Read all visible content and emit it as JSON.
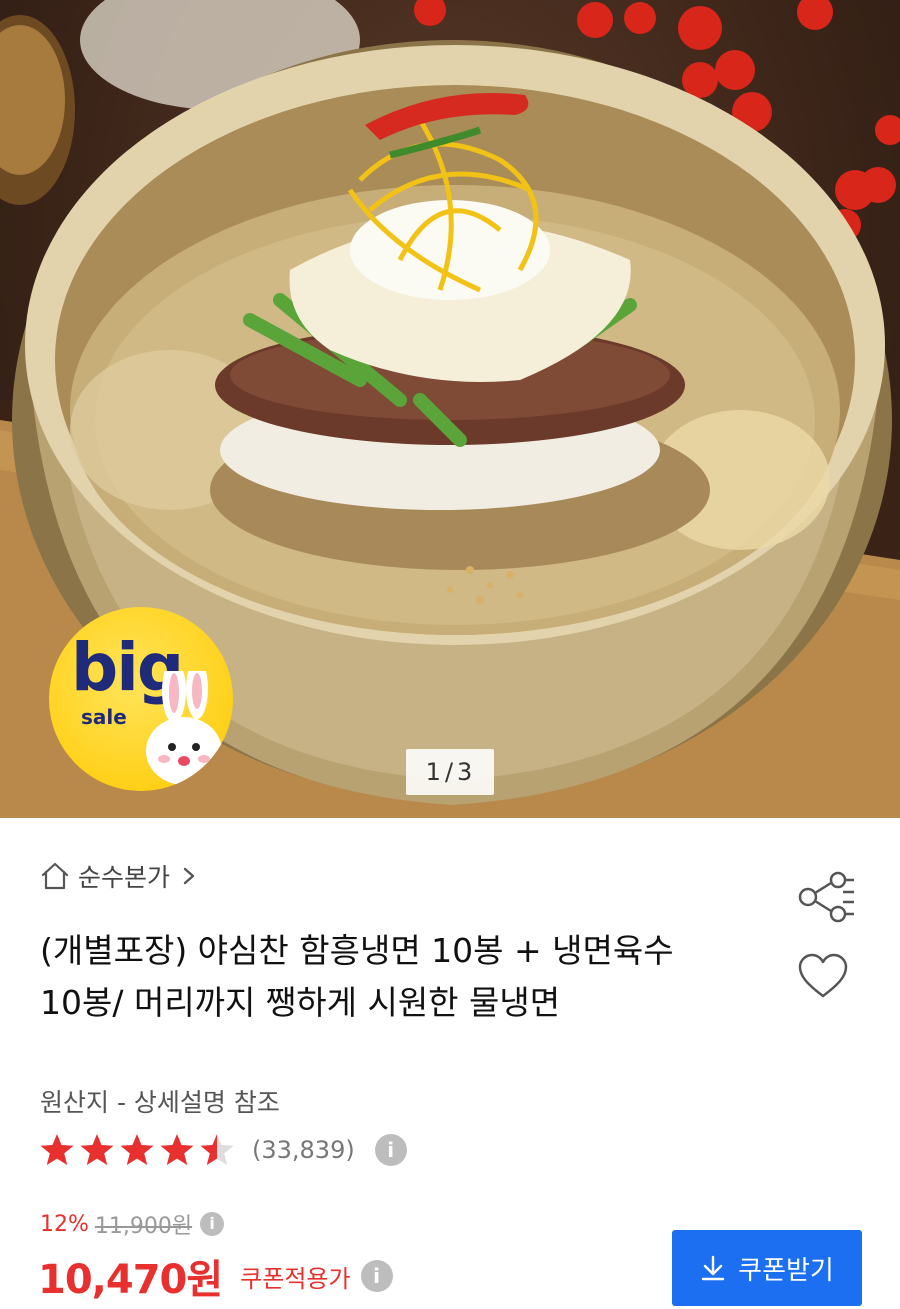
{
  "gallery": {
    "current": "1",
    "separator": "/",
    "total": "3"
  },
  "badge": {
    "big_text": "big",
    "sale_text": "sale"
  },
  "store": {
    "name": "순수본가"
  },
  "product": {
    "title": "(개별포장) 야심찬 함흥냉면 10봉 + 냉면육수 10봉/ 머리까지 쨍하게 시원한 물냉면",
    "origin": "원산지 - 상세설명 참조",
    "rating": {
      "stars": 4.5,
      "max": 5,
      "review_count": "(33,839)"
    }
  },
  "pricing": {
    "discount": "12%",
    "original_price": "11,900원",
    "final_price": "10,470원",
    "final_label": "쿠폰적용가",
    "info_glyph": "i"
  },
  "coupon_button": {
    "label": "쿠폰받기"
  },
  "colors": {
    "accent_red": "#e8302e",
    "button_blue": "#1c6ff0",
    "star_red": "#e8302e"
  },
  "icons": [
    "home-icon",
    "chevron-right-icon",
    "share-icon",
    "heart-icon",
    "star-icon",
    "info-icon",
    "download-icon"
  ]
}
